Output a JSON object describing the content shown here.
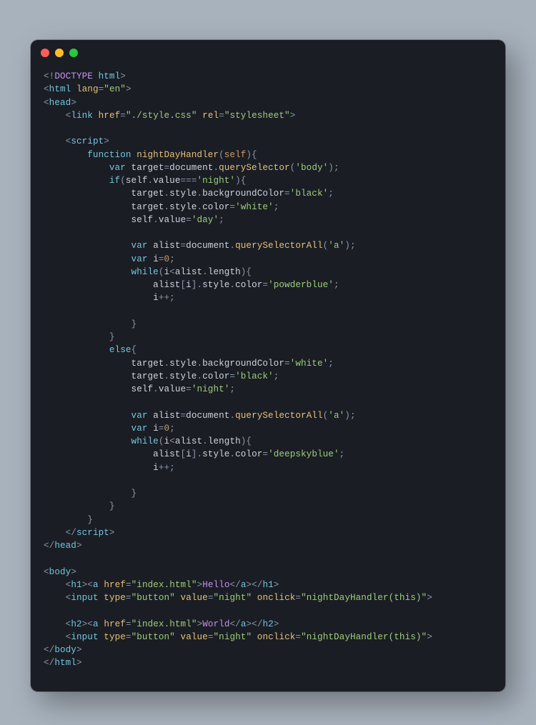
{
  "window": {
    "traffic": [
      "close",
      "minimize",
      "zoom"
    ]
  },
  "code": {
    "line01_doctype": "DOCTYPE",
    "line01_html": "html",
    "tag_html": "html",
    "attr_lang": "lang",
    "val_lang": "\"en\"",
    "tag_head": "head",
    "tag_link": "link",
    "attr_href": "href",
    "val_stylecss": "\"./style.css\"",
    "attr_rel": "rel",
    "val_stylesheet": "\"stylesheet\"",
    "tag_script": "script",
    "kw_function": "function",
    "fn_nightDayHandler": "nightDayHandler",
    "param_self": "self",
    "kw_var": "var",
    "id_target": "target",
    "id_document": "document",
    "fn_querySelector": "querySelector",
    "str_body": "'body'",
    "kw_if": "if",
    "id_self": "self",
    "prop_value": "value",
    "op_eqeqeq": "===",
    "str_night": "'night'",
    "prop_style": "style",
    "prop_backgroundColor": "backgroundColor",
    "str_black": "'black'",
    "prop_color": "color",
    "str_white": "'white'",
    "str_day": "'day'",
    "id_alist": "alist",
    "fn_querySelectorAll": "querySelectorAll",
    "str_a": "'a'",
    "id_i": "i",
    "num_0": "0",
    "kw_while": "while",
    "prop_length": "length",
    "str_powderblue": "'powderblue'",
    "op_pp": "++",
    "kw_else": "else",
    "str_white2": "'white'",
    "str_black2": "'black'",
    "str_night2": "'night'",
    "str_deepskyblue": "'deepskyblue'",
    "tag_body": "body",
    "tag_h1": "h1",
    "tag_h2": "h2",
    "tag_a": "a",
    "val_indexhtml": "\"index.html\"",
    "txt_Hello": "Hello",
    "txt_World": "World",
    "tag_input": "input",
    "attr_type": "type",
    "val_button": "\"button\"",
    "attr_value": "value",
    "val_night": "\"night\"",
    "attr_onclick": "onclick",
    "val_onclick": "\"nightDayHandler(this)\""
  }
}
